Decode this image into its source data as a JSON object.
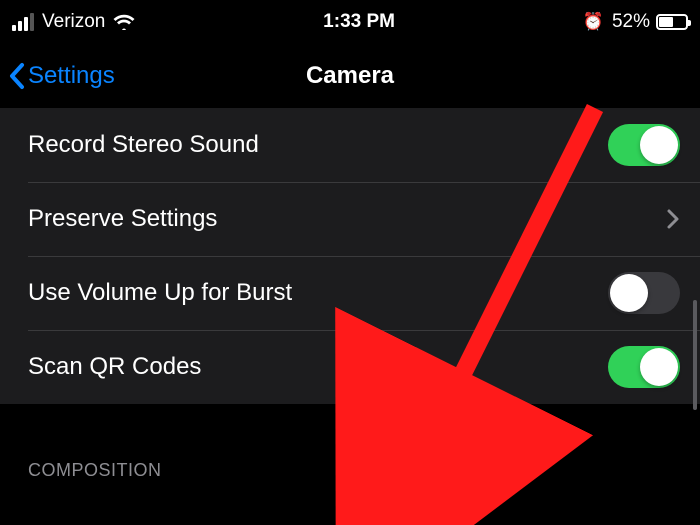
{
  "status": {
    "carrier": "Verizon",
    "time": "1:33 PM",
    "battery_percent": "52%"
  },
  "nav": {
    "back_label": "Settings",
    "title": "Camera"
  },
  "rows": {
    "stereo": {
      "label": "Record Stereo Sound",
      "on": true
    },
    "preserve": {
      "label": "Preserve Settings"
    },
    "burst": {
      "label": "Use Volume Up for Burst",
      "on": false
    },
    "qr": {
      "label": "Scan QR Codes",
      "on": true
    }
  },
  "section": {
    "composition": "COMPOSITION"
  },
  "colors": {
    "accent": "#0a84ff",
    "toggle_on": "#30d158"
  }
}
